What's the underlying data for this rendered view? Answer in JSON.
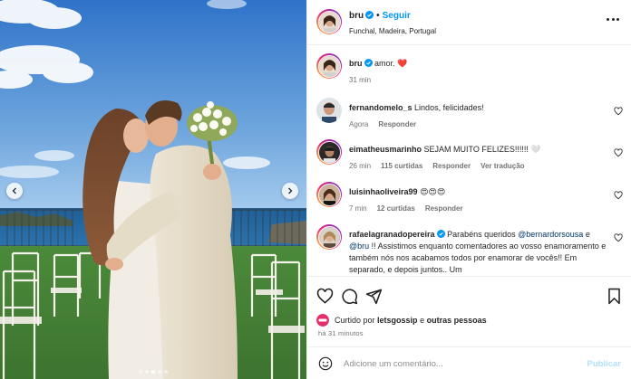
{
  "colors": {
    "accent": "#0095f6",
    "like_red": "#ed4956",
    "muted": "#737373",
    "publish_disabled": "#b2dffc"
  },
  "media": {
    "carousel_total": 5,
    "carousel_active": 2
  },
  "header": {
    "username": "bru",
    "separator": "•",
    "follow_label": "Seguir",
    "location": "Funchal, Madeira, Portugal"
  },
  "caption": {
    "username": "bru",
    "text": "amor.",
    "emoji": "❤️",
    "time": "31 min"
  },
  "comments": [
    {
      "username": "fernandomelo_s",
      "text": "Lindos, felicidades!",
      "time": "Agora",
      "reply": "Responder"
    },
    {
      "username": "eimatheusmarinho",
      "text": "SEJAM MUITO FELIZES!!!!!! 🤍",
      "time": "26 min",
      "likes": "115 curtidas",
      "reply": "Responder",
      "translate": "Ver tradução"
    },
    {
      "username": "luisinhaoliveira99",
      "text": "😍😍😍",
      "time": "7 min",
      "likes": "12 curtidas",
      "reply": "Responder"
    },
    {
      "username": "rafaelagranadopereira",
      "text_parts": [
        "Parabéns queridos ",
        "@bernardorsousa",
        " e ",
        "@bru",
        " !! Assistimos enquanto comentadores ao vosso enamoramento e também nós nos acabamos todos por enamorar de vocês!! Em separado, e depois juntos.. Um"
      ]
    }
  ],
  "icons": {
    "like": "heart-icon",
    "comment": "comment-icon",
    "share": "share-icon",
    "save": "bookmark-icon",
    "emoji": "emoji-icon",
    "more": "more-icon"
  },
  "likes": {
    "prefix": "Curtido por ",
    "user": "letsgossip",
    "middle": " e ",
    "others": "outras pessoas"
  },
  "post_time": "há 31 minutos",
  "add_comment": {
    "placeholder": "Adicione um comentário...",
    "publish": "Publicar"
  }
}
